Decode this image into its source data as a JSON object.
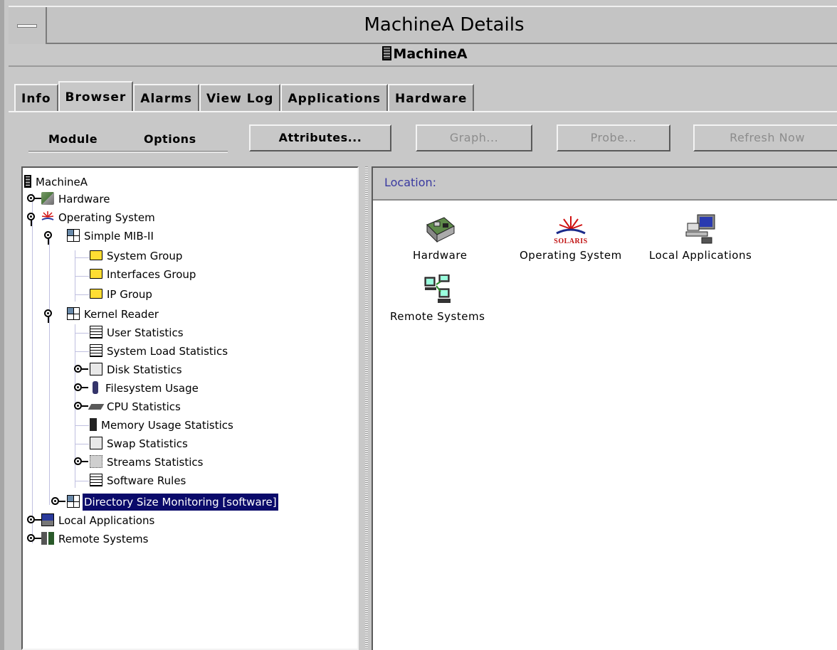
{
  "window": {
    "title": "MachineA Details",
    "host": "MachineA"
  },
  "tabs": [
    "Info",
    "Browser",
    "Alarms",
    "View Log",
    "Applications",
    "Hardware"
  ],
  "active_tab": "Browser",
  "toolbar": {
    "menus": [
      "Module",
      "Options"
    ],
    "attributes_label": "Attributes...",
    "graph_label": "Graph...",
    "probe_label": "Probe...",
    "refresh_label": "Refresh Now"
  },
  "tree": [
    {
      "label": "MachineA",
      "icon": "server-icon"
    },
    {
      "label": "Hardware",
      "icon": "hardware-icon",
      "state": "collapsed"
    },
    {
      "label": "Operating System",
      "icon": "solaris-icon",
      "state": "expanded"
    },
    {
      "label": "Simple MIB-II",
      "icon": "module-icon",
      "state": "expanded"
    },
    {
      "label": "System Group",
      "icon": "folder-icon"
    },
    {
      "label": "Interfaces Group",
      "icon": "folder-icon"
    },
    {
      "label": "IP Group",
      "icon": "folder-icon"
    },
    {
      "label": "Kernel Reader",
      "icon": "module-icon",
      "state": "expanded"
    },
    {
      "label": "User Statistics",
      "icon": "table-icon"
    },
    {
      "label": "System Load Statistics",
      "icon": "load-icon"
    },
    {
      "label": "Disk Statistics",
      "icon": "gauge-icon",
      "state": "collapsed"
    },
    {
      "label": "Filesystem Usage",
      "icon": "filesystem-icon",
      "state": "collapsed"
    },
    {
      "label": "CPU Statistics",
      "icon": "cpu-icon",
      "state": "collapsed"
    },
    {
      "label": "Memory Usage Statistics",
      "icon": "memory-icon"
    },
    {
      "label": "Swap Statistics",
      "icon": "gauge-icon"
    },
    {
      "label": "Streams Statistics",
      "icon": "streams-icon",
      "state": "collapsed"
    },
    {
      "label": "Software Rules",
      "icon": "load-icon"
    },
    {
      "label": "Directory Size Monitoring [software]",
      "icon": "module-icon",
      "state": "collapsed",
      "selected": true
    },
    {
      "label": "Local Applications",
      "icon": "applications-icon",
      "state": "collapsed"
    },
    {
      "label": "Remote Systems",
      "icon": "remote-systems-icon",
      "state": "collapsed"
    }
  ],
  "location_label": "Location:",
  "content_icons": [
    {
      "label": "Hardware",
      "icon": "hardware-icon"
    },
    {
      "label": "Operating System",
      "icon": "solaris-icon",
      "logo_text": "SOLARIS"
    },
    {
      "label": "Local Applications",
      "icon": "applications-icon"
    },
    {
      "label": "Remote Systems",
      "icon": "remote-systems-icon"
    }
  ],
  "colors": {
    "selection": "#0a0a6a",
    "location_text": "#3a3aa0",
    "folder": "#ffdd33"
  }
}
